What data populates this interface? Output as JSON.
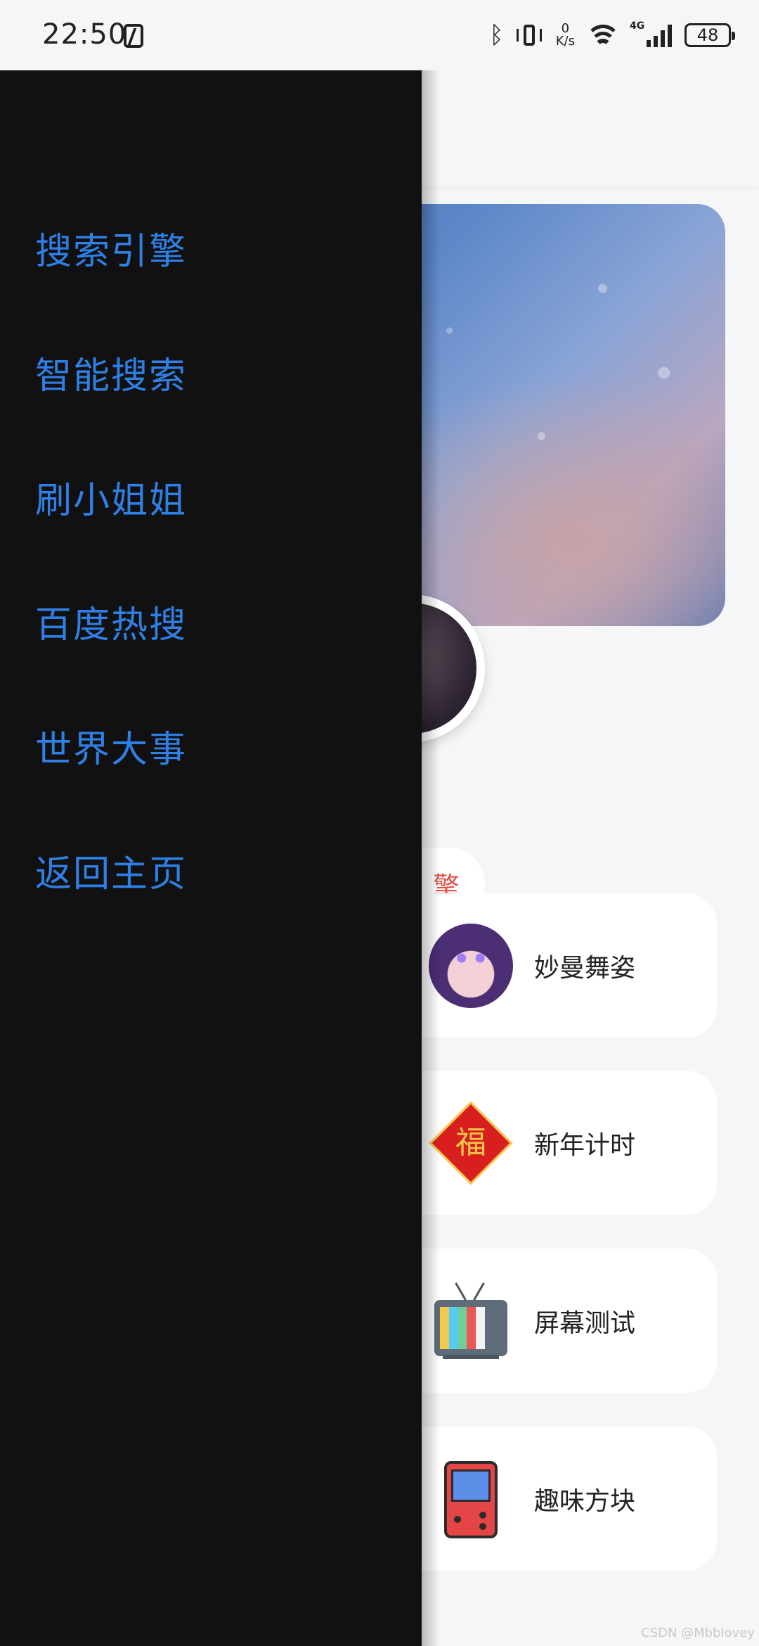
{
  "status_bar": {
    "time": "22:50",
    "network_speed_value": "0",
    "network_speed_unit": "K/s",
    "signal_label": "4G",
    "battery_level": "48",
    "icons": [
      "nfc-icon",
      "bluetooth-icon",
      "vibrate-icon",
      "wifi-icon",
      "signal-icon",
      "battery-icon"
    ]
  },
  "drawer": {
    "menu_items": [
      {
        "label": "搜索引擎"
      },
      {
        "label": "智能搜索"
      },
      {
        "label": "刷小姐姐"
      },
      {
        "label": "百度热搜"
      },
      {
        "label": "世界大事"
      },
      {
        "label": "返回主页"
      }
    ],
    "menu_color": "#2f80e6",
    "background_color": "#111112"
  },
  "main": {
    "partial_tag_text": "擎",
    "partial_tag_color": "#e0524a",
    "cards": [
      {
        "label": "妙曼舞姿",
        "icon": "dance-avatar-icon"
      },
      {
        "label": "新年计时",
        "icon": "fu-character-icon"
      },
      {
        "label": "屏幕测试",
        "icon": "retro-tv-icon"
      },
      {
        "label": "趣味方块",
        "icon": "game-console-icon"
      }
    ]
  },
  "watermark": "CSDN @Mbblovey"
}
